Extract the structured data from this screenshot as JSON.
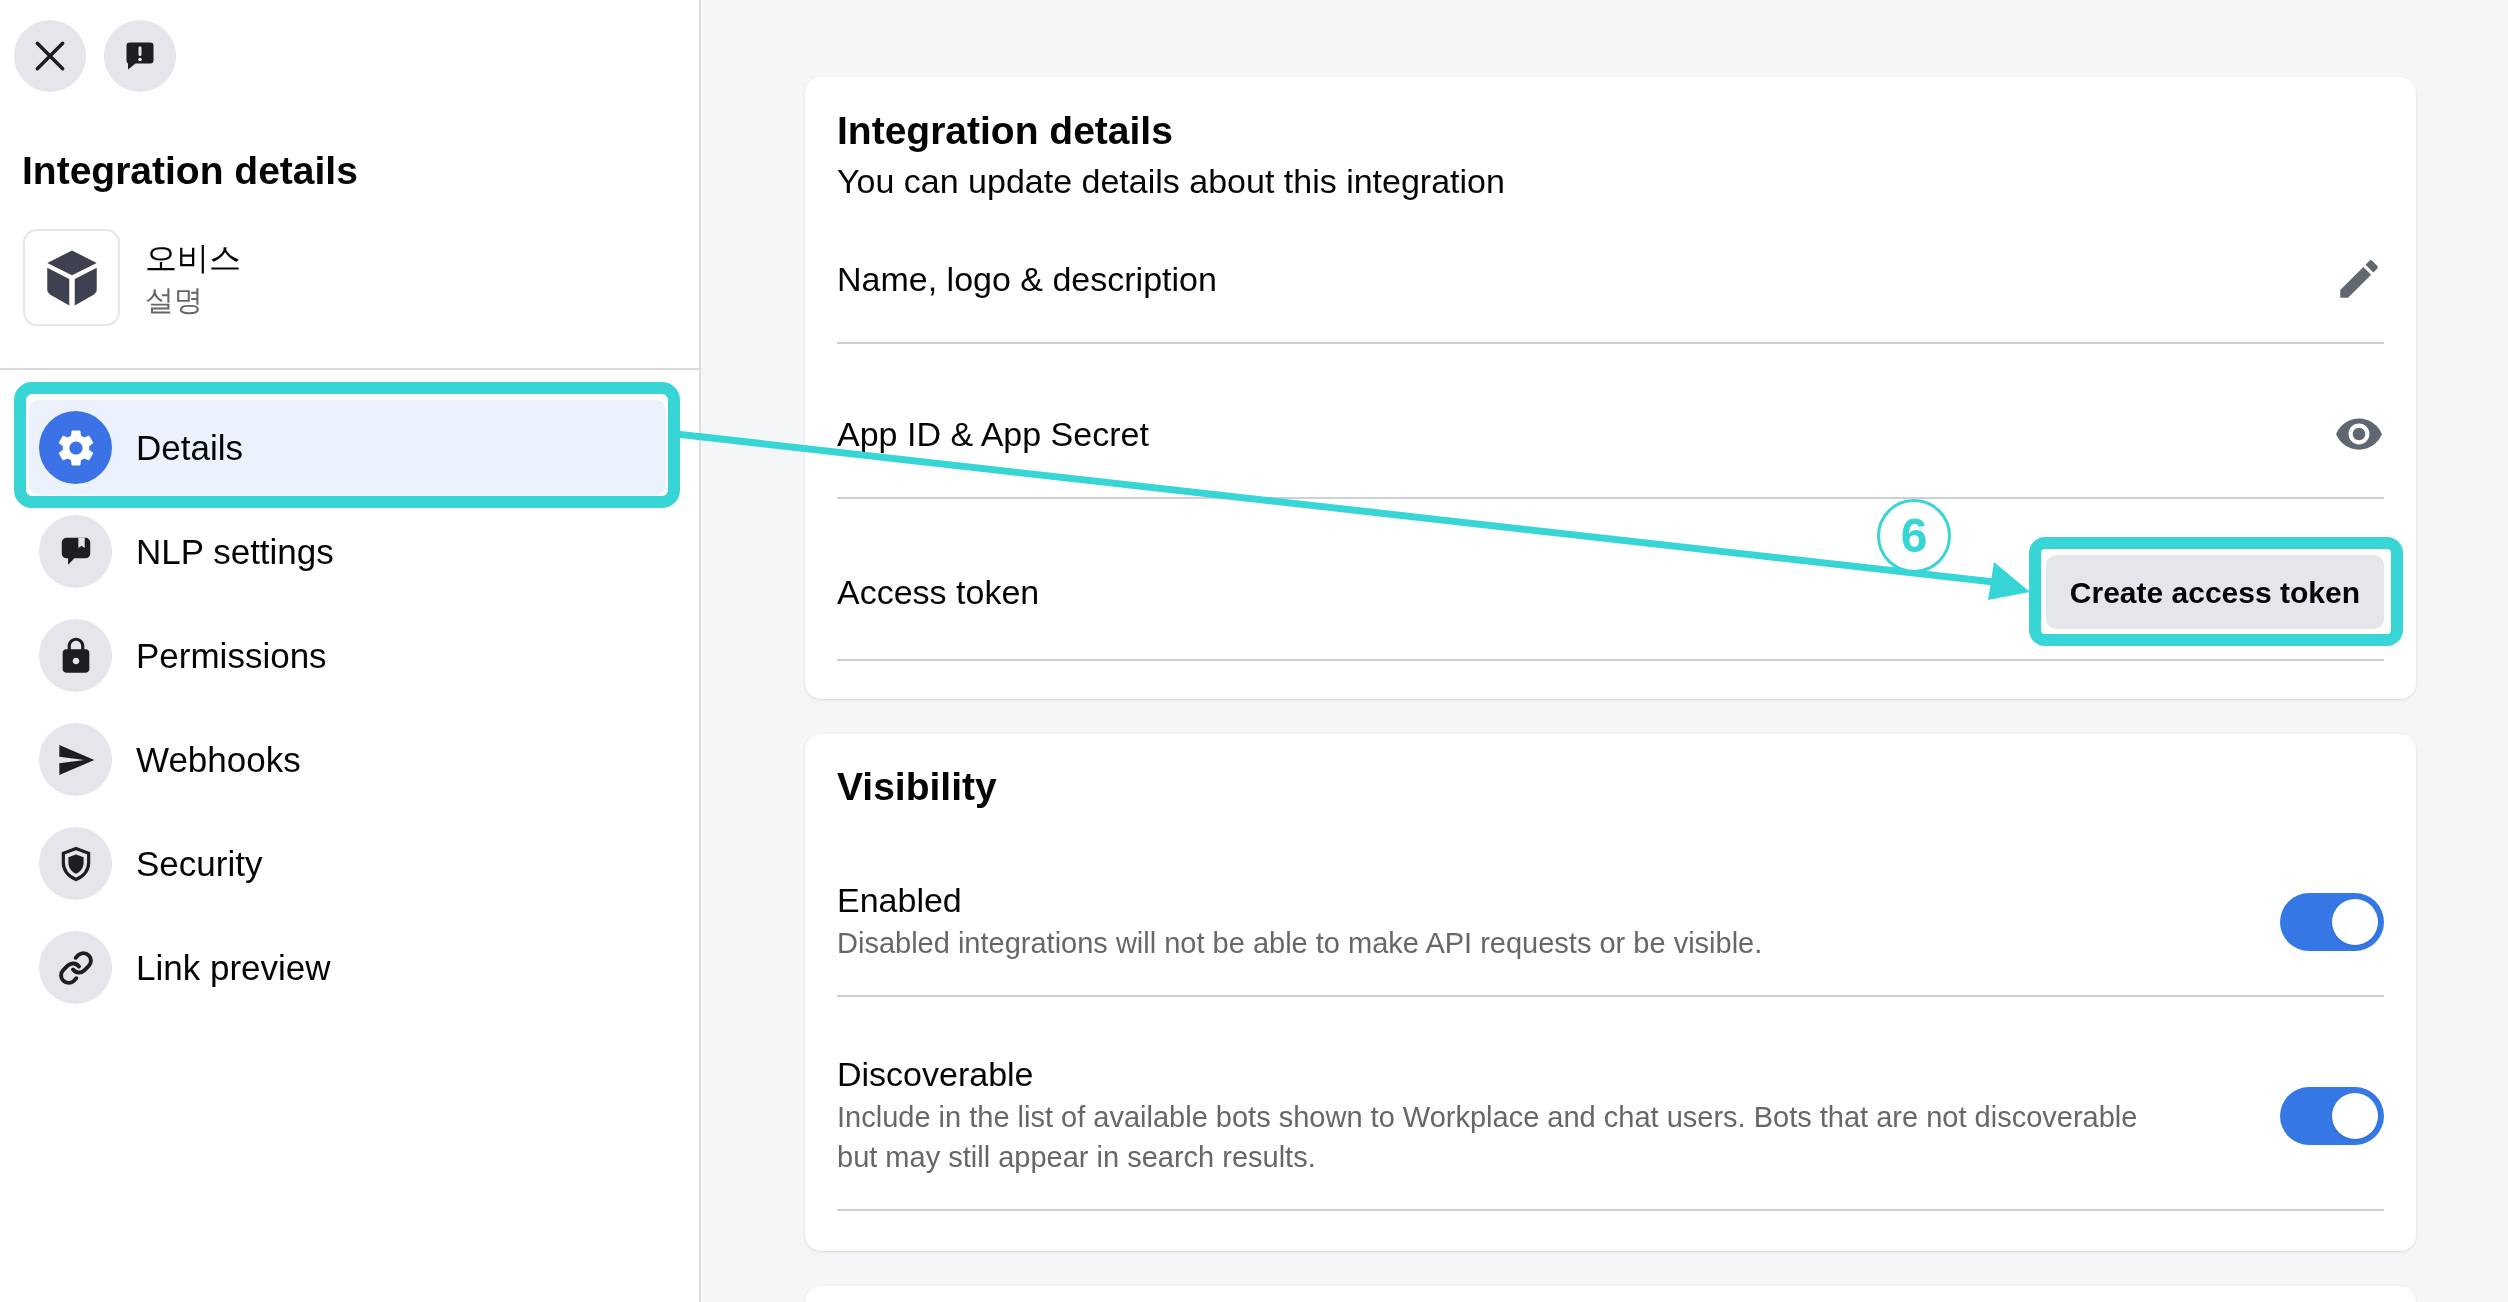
{
  "sidebar": {
    "title": "Integration details",
    "app": {
      "name": "오비스",
      "description": "설명"
    },
    "items": [
      {
        "label": "Details",
        "selected": true
      },
      {
        "label": "NLP settings",
        "selected": false
      },
      {
        "label": "Permissions",
        "selected": false
      },
      {
        "label": "Webhooks",
        "selected": false
      },
      {
        "label": "Security",
        "selected": false
      },
      {
        "label": "Link preview",
        "selected": false
      }
    ]
  },
  "details_card": {
    "title": "Integration details",
    "subtitle": "You can update details about this integration",
    "rows": [
      {
        "label": "Name, logo & description",
        "kind": "edit"
      },
      {
        "label": "App ID & App Secret",
        "kind": "view"
      },
      {
        "label": "Access token",
        "kind": "button",
        "button": "Create access token"
      }
    ]
  },
  "visibility": {
    "title": "Visibility",
    "settings": [
      {
        "label": "Enabled",
        "description": "Disabled integrations will not be able to make API requests or be visible.",
        "on": true
      },
      {
        "label": "Discoverable",
        "description": "Include in the list of available bots shown to Workplace and chat users. Bots that are not discoverable but may still appear in search results.",
        "on": true
      }
    ]
  },
  "annotation": {
    "step": "6"
  }
}
